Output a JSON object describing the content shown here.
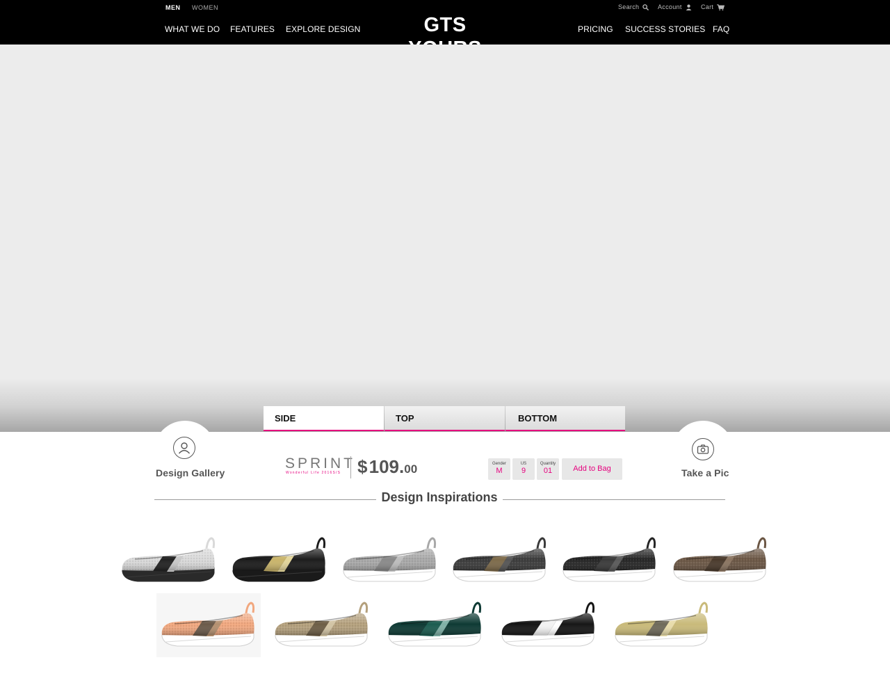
{
  "header": {
    "gender_tabs": [
      "MEN",
      "WOMEN"
    ],
    "search_label": "Search",
    "account_label": "Account",
    "cart_label": "Cart",
    "nav_left": [
      "WHAT WE DO",
      "FEATURES",
      "EXPLORE DESIGN"
    ],
    "logo": "GTS YOURS",
    "nav_right": [
      "PRICING",
      "SUCCESS STORIES",
      "FAQ"
    ]
  },
  "view_tabs": [
    "SIDE",
    "TOP",
    "BOTTOM"
  ],
  "active_view": "SIDE",
  "design_gallery_label": "Design Gallery",
  "take_pic_label": "Take a Pic",
  "product": {
    "name": "SPRINT",
    "collection": "Wonderful Life 2016S/S",
    "currency": "$",
    "price_major": "109.",
    "price_minor": "00"
  },
  "options": {
    "gender": {
      "label": "Gender",
      "value": "M"
    },
    "size": {
      "label": "US",
      "value": "9"
    },
    "quantity": {
      "label": "Quantity",
      "value": "01"
    }
  },
  "add_to_bag_label": "Add to Bag",
  "inspirations_title": "Design Inspirations",
  "colors": {
    "accent": "#e6007e",
    "header_bg": "#000000",
    "stage_bg": "#ececec"
  },
  "inspirations": [
    {
      "name": "silver-snakeskin",
      "upper": "#d9d9d9",
      "band": "#222222",
      "stripe": "#c8c8c8",
      "sole": "#2a2a2a",
      "texture": true
    },
    {
      "name": "black-gold",
      "upper": "#1c1c1c",
      "band": "#c9b46a",
      "stripe": "#e3d59a",
      "sole": "#1a1a1a",
      "texture": false
    },
    {
      "name": "grey-knit",
      "upper": "#a8a8a8",
      "band": "#8a8a8a",
      "stripe": "#bdbdbd",
      "sole": "#ffffff",
      "texture": true
    },
    {
      "name": "charcoal-bronze",
      "upper": "#3a3a3a",
      "band": "#7d6a4a",
      "stripe": "#555555",
      "sole": "#ffffff",
      "texture": true
    },
    {
      "name": "black-knit",
      "upper": "#252525",
      "band": "#3a3a3a",
      "stripe": "#5a5a5a",
      "sole": "#ffffff",
      "texture": true
    },
    {
      "name": "brown-tweed",
      "upper": "#6b5644",
      "band": "#4a3a2c",
      "stripe": "#8a7460",
      "sole": "#ffffff",
      "texture": true
    },
    {
      "name": "peach",
      "upper": "#f1a77e",
      "band": "#6b5a4a",
      "stripe": "#b49070",
      "sole": "#ffffff",
      "texture": true
    },
    {
      "name": "khaki-knit",
      "upper": "#b4a07c",
      "band": "#6d5e46",
      "stripe": "#d2c4a4",
      "sole": "#ffffff",
      "texture": true
    },
    {
      "name": "emerald",
      "upper": "#0e3a34",
      "band": "#1b5c50",
      "stripe": "#7fb0a6",
      "sole": "#ffffff",
      "texture": false
    },
    {
      "name": "black-white",
      "upper": "#161616",
      "band": "#f2f2f2",
      "stripe": "#ffffff",
      "sole": "#ffffff",
      "texture": false
    },
    {
      "name": "gold-metallic",
      "upper": "#c9ba7a",
      "band": "#6f6a5a",
      "stripe": "#e8dcaa",
      "sole": "#ffffff",
      "texture": false
    }
  ]
}
